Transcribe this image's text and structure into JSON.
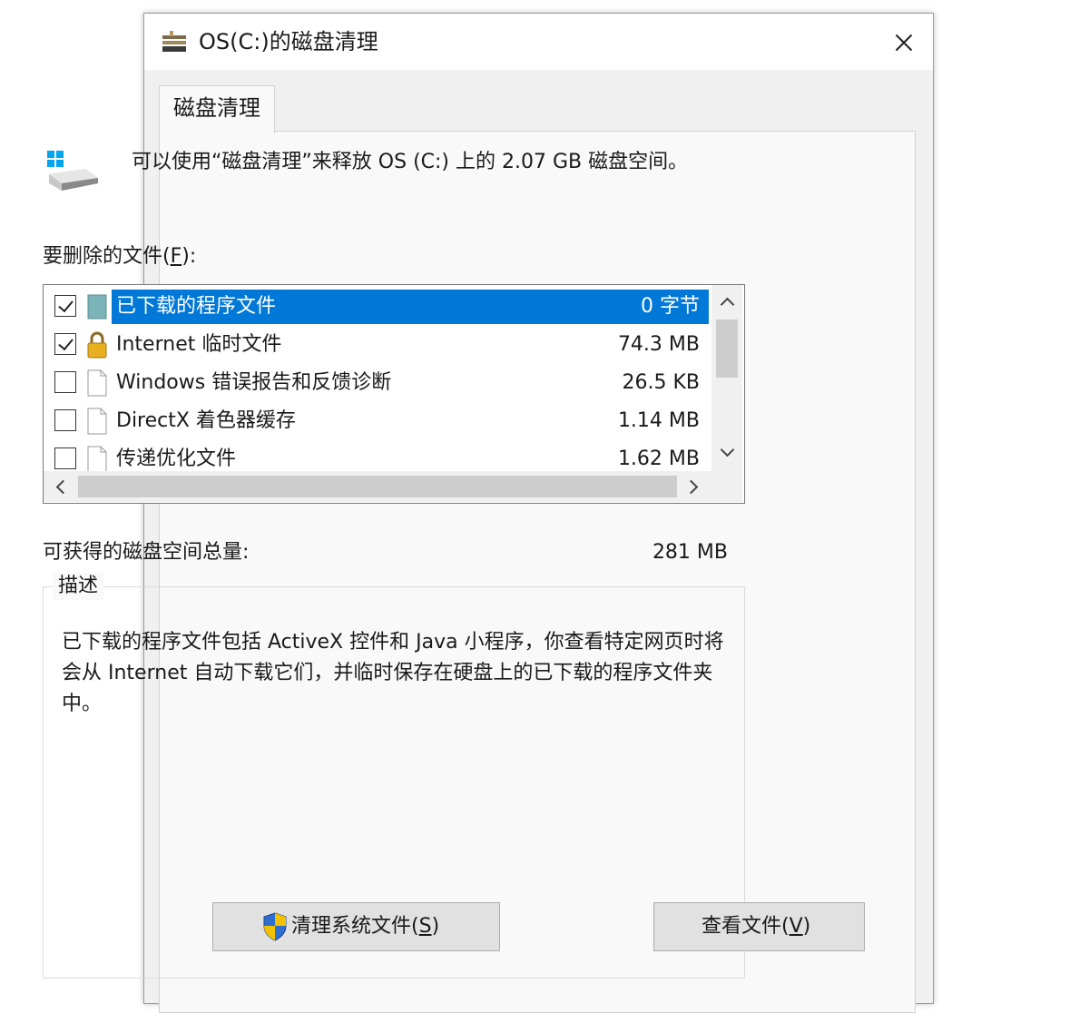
{
  "window": {
    "title": "OS(C:)的磁盘清理"
  },
  "tab": {
    "label": "磁盘清理"
  },
  "intro_text": "可以使用“磁盘清理”来释放 OS (C:) 上的 2.07 GB 磁盘空间。",
  "files_label": {
    "text": "要删除的文件(",
    "accel": "F",
    "suffix": "):"
  },
  "files": [
    {
      "name": "已下载的程序文件",
      "size": "0 字节",
      "checked": true,
      "selected": true,
      "icon": "folder-icon"
    },
    {
      "name": "Internet 临时文件",
      "size": "74.3 MB",
      "checked": true,
      "selected": false,
      "icon": "lock-icon"
    },
    {
      "name": "Windows 错误报告和反馈诊断",
      "size": "26.5 KB",
      "checked": false,
      "selected": false,
      "icon": "file-icon"
    },
    {
      "name": "DirectX 着色器缓存",
      "size": "1.14 MB",
      "checked": false,
      "selected": false,
      "icon": "file-icon"
    },
    {
      "name": "传递优化文件",
      "size": "1.62 MB",
      "checked": false,
      "selected": false,
      "icon": "file-icon"
    }
  ],
  "total": {
    "label": "可获得的磁盘空间总量:",
    "value": "281 MB"
  },
  "description": {
    "legend": "描述",
    "text": "已下载的程序文件包括 ActiveX 控件和 Java 小程序，你查看特定网页时将会从 Internet 自动下载它们，并临时保存在硬盘上的已下载的程序文件夹中。"
  },
  "buttons": {
    "cleanup_system": {
      "text": "清理系统文件(",
      "accel": "S",
      "suffix": ")"
    },
    "view_files": {
      "text": "查看文件(",
      "accel": "V",
      "suffix": ")"
    }
  },
  "colors": {
    "selection": "#0078d7",
    "window_bg": "#f0f0f0",
    "panel_bg": "#f9f9f9"
  }
}
